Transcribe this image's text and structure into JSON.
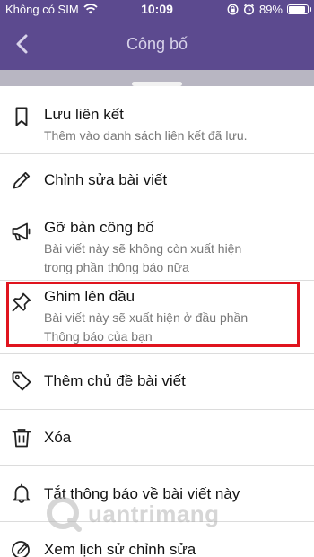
{
  "status_bar": {
    "carrier": "Không có SIM",
    "time": "10:09",
    "battery": "89%",
    "battery_level": 0.89
  },
  "nav": {
    "title": "Công bố"
  },
  "menu": [
    {
      "title": "Lưu liên kết",
      "subtitle": "Thêm vào danh sách liên kết đã lưu.",
      "icon": "bookmark-icon"
    },
    {
      "title": "Chỉnh sửa bài viết",
      "subtitle": "",
      "icon": "pencil-icon"
    },
    {
      "title": "Gỡ bản công bố",
      "subtitle_lines": [
        "Bài viết này sẽ không còn xuất hiện",
        "trong phần thông báo nữa"
      ],
      "icon": "megaphone-icon"
    },
    {
      "title": "Ghim lên đầu",
      "subtitle_lines": [
        "Bài viết này sẽ xuất hiện ở đầu phần",
        "Thông báo của bạn"
      ],
      "icon": "pin-icon"
    },
    {
      "title": "Thêm chủ đề bài viết",
      "subtitle": "",
      "icon": "tag-icon"
    },
    {
      "title": "Xóa",
      "subtitle": "",
      "icon": "trash-icon"
    },
    {
      "title": "Tắt thông báo về bài viết này",
      "subtitle": "",
      "icon": "bell-icon"
    },
    {
      "title": "Xem lịch sử chỉnh sửa",
      "subtitle": "",
      "icon": "edit-history-icon"
    }
  ],
  "watermark": {
    "text": "uantrimang"
  },
  "colors": {
    "header": "#5c4a8f",
    "highlight": "#e0141e"
  }
}
